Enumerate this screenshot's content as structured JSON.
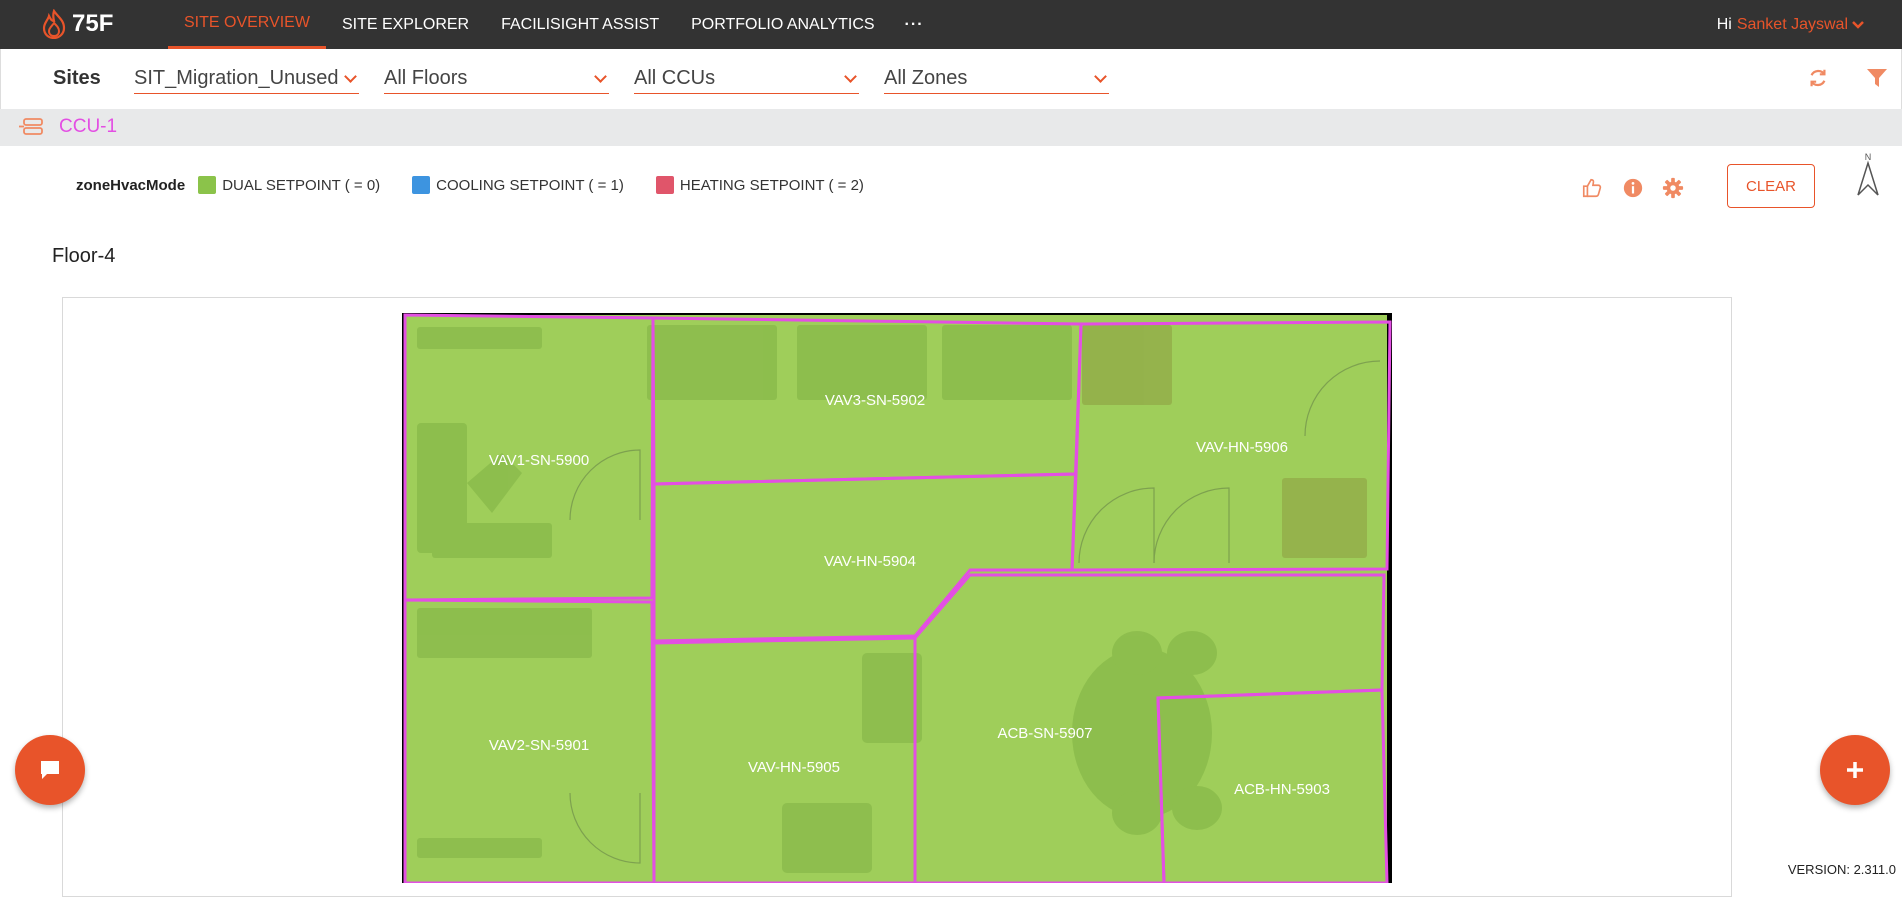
{
  "brand": {
    "logo_text": "75F",
    "accent": "#e8542a",
    "topbar_bg": "#333333"
  },
  "nav": {
    "items": [
      {
        "label": "SITE OVERVIEW",
        "active": true
      },
      {
        "label": "SITE EXPLORER",
        "active": false
      },
      {
        "label": "FACILISIGHT ASSIST",
        "active": false
      },
      {
        "label": "PORTFOLIO ANALYTICS",
        "active": false
      }
    ],
    "more_label": "···"
  },
  "user": {
    "greeting": "Hi",
    "name": "Sanket Jayswal"
  },
  "filters": {
    "sites_label": "Sites",
    "site": "SIT_Migration_Unused",
    "floor": "All Floors",
    "ccu": "All CCUs",
    "zone": "All Zones"
  },
  "ccu": {
    "label": "CCU-1",
    "color": "#e34fe3"
  },
  "legend": {
    "title": "zoneHvacMode",
    "items": [
      {
        "label": "DUAL SETPOINT ( = 0)",
        "color": "#8bc34a"
      },
      {
        "label": "COOLING SETPOINT ( = 1)",
        "color": "#3d94e0"
      },
      {
        "label": "HEATING SETPOINT ( = 2)",
        "color": "#e0556a"
      }
    ]
  },
  "actions": {
    "clear_label": "CLEAR",
    "north_label": "N"
  },
  "floor": {
    "title": "Floor-4"
  },
  "zones": [
    {
      "name": "VAV1-SN-5900"
    },
    {
      "name": "VAV3-SN-5902"
    },
    {
      "name": "VAV-HN-5906"
    },
    {
      "name": "VAV-HN-5904"
    },
    {
      "name": "VAV2-SN-5901"
    },
    {
      "name": "VAV-HN-5905"
    },
    {
      "name": "ACB-SN-5907"
    },
    {
      "name": "ACB-HN-5903"
    }
  ],
  "zone_style": {
    "fill": "#9fce5a",
    "border": "#e34fe3"
  },
  "version": "VERSION: 2.311.0"
}
